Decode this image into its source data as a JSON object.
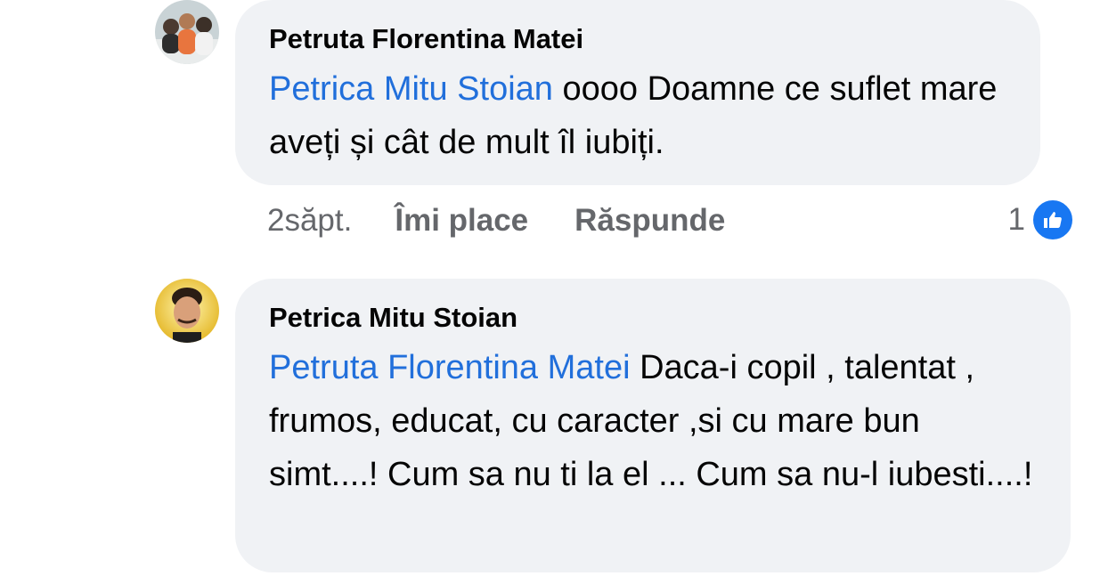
{
  "comments": [
    {
      "author": "Petruta Florentina Matei",
      "mention": "Petrica Mitu Stoian",
      "text": " oooo Doamne ce suflet mare aveți și cât de mult îl iubiți.",
      "time": "2săpt.",
      "like_label": "Îmi place",
      "reply_label": "Răspunde",
      "reaction_count": "1",
      "reaction_icon": "like-icon"
    },
    {
      "author": "Petrica Mitu Stoian",
      "mention": "Petruta Florentina Matei",
      "text": " Daca-i copil  , talentat , frumos, educat, cu caracter ,si cu mare bun simt....! Cum sa nu ti la el ... Cum sa nu-l iubesti....!"
    }
  ],
  "colors": {
    "mention": "#216fdb",
    "bubble": "#f0f2f5",
    "meta": "#65676b",
    "like_badge": "#1877f2"
  }
}
